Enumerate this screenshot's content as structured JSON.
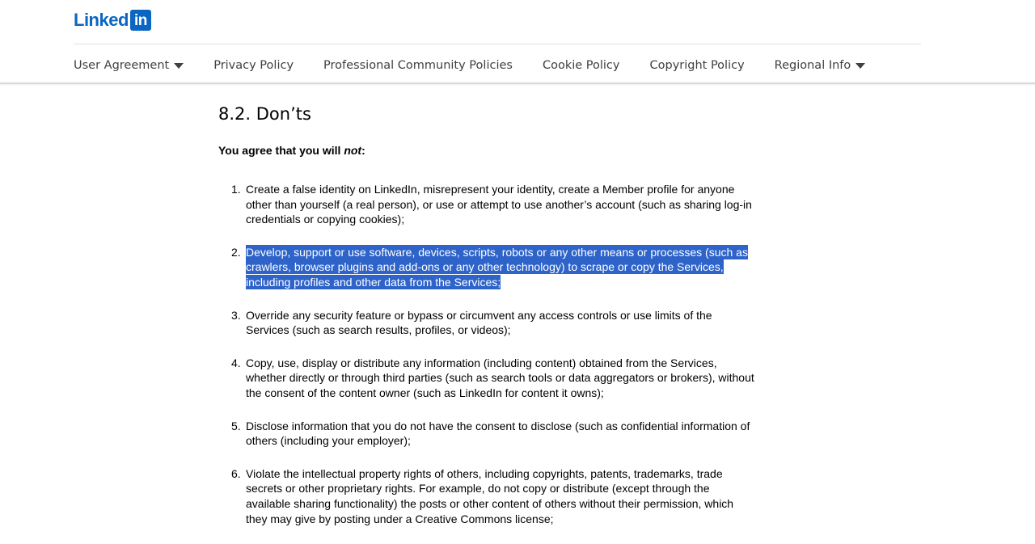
{
  "header": {
    "logo": {
      "word": "Linked",
      "badge": "in",
      "brand_color": "#0a66c2"
    },
    "nav": {
      "items": [
        {
          "label": "User Agreement",
          "has_dropdown": true
        },
        {
          "label": "Privacy Policy",
          "has_dropdown": false
        },
        {
          "label": "Professional Community Policies",
          "has_dropdown": false
        },
        {
          "label": "Cookie Policy",
          "has_dropdown": false
        },
        {
          "label": "Copyright Policy",
          "has_dropdown": false
        },
        {
          "label": "Regional Info",
          "has_dropdown": true
        }
      ]
    }
  },
  "main": {
    "section_title": "8.2. Don’ts",
    "intro_before": "You agree that you will ",
    "intro_emphasis": "not",
    "intro_after": ":",
    "selection_color": "#2e63c9",
    "items": [
      {
        "number": "1.",
        "text": "Create a false identity on LinkedIn, misrepresent your identity, create a Member profile for anyone other than yourself (a real person), or use or attempt to use another’s account (such as sharing log-in credentials or copying cookies);",
        "selected": false
      },
      {
        "number": "2.",
        "text": "Develop, support or use software, devices, scripts, robots or any other means or processes (such as crawlers, browser plugins and add-ons or any other technology) to scrape or copy the Services, including profiles and other data from the Services;",
        "selected": true
      },
      {
        "number": "3.",
        "text": "Override any security feature or bypass or circumvent any access controls or use limits of the Services (such as search results, profiles, or videos);",
        "selected": false
      },
      {
        "number": "4.",
        "text": "Copy, use, display or distribute any information (including content) obtained from the Services, whether directly or through third parties (such as search tools or data aggregators or brokers), without the consent of the content owner (such as LinkedIn for content it owns);",
        "selected": false
      },
      {
        "number": "5.",
        "text": "Disclose information that you do not have the consent to disclose (such as confidential information of others (including your employer);",
        "selected": false
      },
      {
        "number": "6.",
        "text": "Violate the intellectual property rights of others, including copyrights, patents, trademarks, trade secrets or other proprietary rights. For example, do not copy or distribute (except through the available sharing functionality) the posts or other content of others without their permission, which they may give by posting under a Creative Commons license;",
        "selected": false
      }
    ]
  }
}
